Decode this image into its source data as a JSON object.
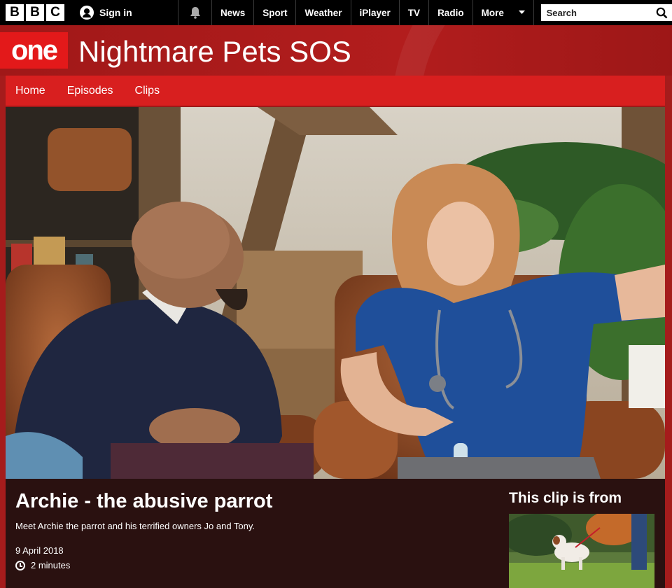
{
  "global_nav": {
    "logo_letters": [
      "B",
      "B",
      "C"
    ],
    "sign_in": "Sign in",
    "links": [
      "News",
      "Sport",
      "Weather",
      "iPlayer",
      "TV",
      "Radio"
    ],
    "more": "More",
    "search_placeholder": "Search",
    "icons": [
      "user-icon",
      "bell-icon",
      "caret-down-icon",
      "search-icon"
    ]
  },
  "masthead": {
    "channel_logo": "one",
    "title": "Nightmare Pets SOS",
    "brand_color": "#b21d1d",
    "logo_color": "#e3191a"
  },
  "programme_nav": {
    "items": [
      "Home",
      "Episodes",
      "Clips"
    ]
  },
  "clip": {
    "title": "Archie - the abusive parrot",
    "description": "Meet Archie the parrot and his terrified owners Jo and Tony.",
    "date": "9 April 2018",
    "duration": "2 minutes"
  },
  "sidebar": {
    "heading": "This clip is from"
  }
}
